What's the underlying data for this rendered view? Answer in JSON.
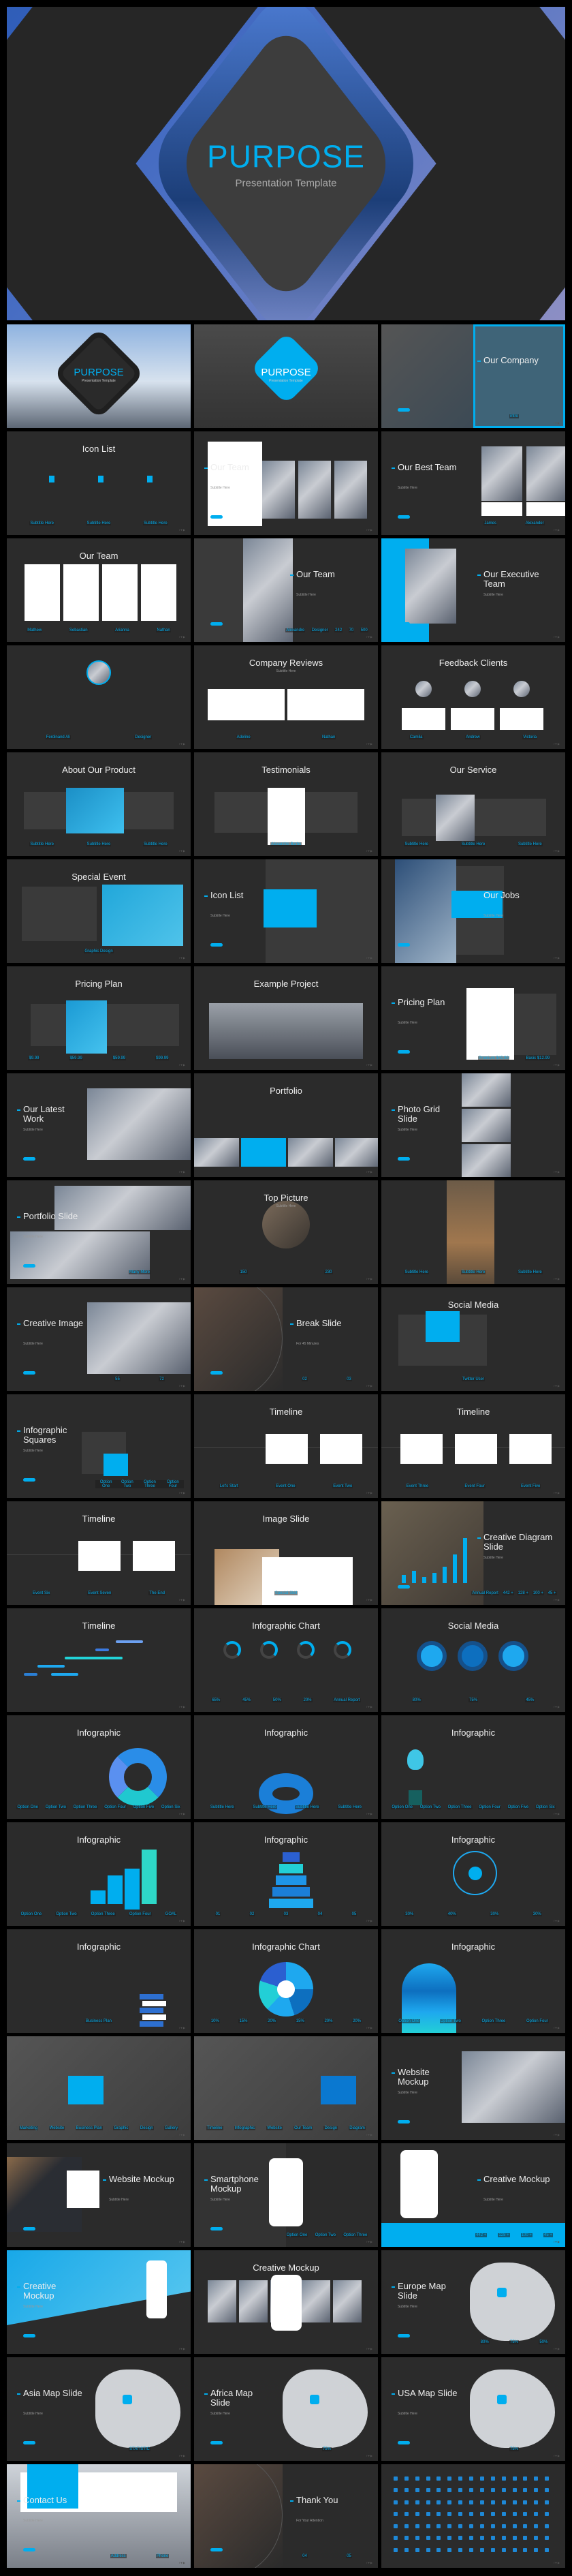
{
  "accent_color": "#00aeef",
  "background_color": "#2b2b2b",
  "hero": {
    "title": "PURPOSE",
    "subtitle": "Presentation Template"
  },
  "slides": [
    {
      "title": "PURPOSE",
      "subtitle": "Presentation Template",
      "layout": "cover",
      "deco": "cover-photo"
    },
    {
      "title": "PURPOSE",
      "subtitle": "Presentation Template",
      "layout": "cover",
      "deco": "cover-blue"
    },
    {
      "title": "Our Company",
      "layout": "left right-title",
      "deco": "company",
      "items": [
        "intro"
      ]
    },
    {
      "title": "Icon List",
      "layout": "center",
      "deco": "icons3",
      "items": [
        "Subtitle Here",
        "Subtitle Here",
        "Subtitle Here"
      ]
    },
    {
      "title": "Our Team",
      "subtitle": "Subtitle Here",
      "layout": "left",
      "deco": "team-photos"
    },
    {
      "title": "Our Best Team",
      "subtitle": "Subtitle Here",
      "layout": "left",
      "deco": "photo-right2",
      "items": [
        "James",
        "Alexander"
      ]
    },
    {
      "title": "Our Team",
      "layout": "center",
      "deco": "cards4",
      "items": [
        "Mathew",
        "Sebastian",
        "Arianna",
        "Nathan"
      ]
    },
    {
      "title": "Our Team",
      "subtitle": "Subtitle Here",
      "layout": "left right-title",
      "deco": "profile",
      "items": [
        "Alexandre",
        "Designer",
        "242",
        "70",
        "500"
      ]
    },
    {
      "title": "Our Executive Team",
      "subtitle": "Subtitle Here",
      "layout": "left right-title",
      "deco": "executive"
    },
    {
      "title": "",
      "layout": "center",
      "deco": "avatar",
      "items": [
        "Ferdinand Ali",
        "Designer"
      ]
    },
    {
      "title": "Company Reviews",
      "subtitle": "Subtitle Here",
      "layout": "center",
      "deco": "cards2",
      "items": [
        "Adeline",
        "Nathan"
      ]
    },
    {
      "title": "Feedback Clients",
      "layout": "center",
      "deco": "cards3",
      "items": [
        "Camila",
        "Andrew",
        "Victoria"
      ]
    },
    {
      "title": "About Our Product",
      "layout": "center",
      "deco": "panel3",
      "items": [
        "Subtitle Here",
        "Subtitle Here",
        "Subtitle Here"
      ]
    },
    {
      "title": "Testimonials",
      "layout": "center",
      "deco": "panel5",
      "items": [
        "Alexandre Barbs"
      ]
    },
    {
      "title": "Our Service",
      "layout": "center",
      "deco": "panel4",
      "items": [
        "Subtitle Here",
        "Subtitle Here",
        "Subtitle Here"
      ]
    },
    {
      "title": "Special Event",
      "layout": "center",
      "deco": "event",
      "items": [
        "Graphic Design"
      ]
    },
    {
      "title": "Icon List",
      "subtitle": "Subtitle Here",
      "layout": "left",
      "deco": "iconlist"
    },
    {
      "title": "Our Jobs",
      "subtitle": "Subtitle Here",
      "layout": "left right-title",
      "deco": "jobs"
    },
    {
      "title": "Pricing Plan",
      "layout": "center",
      "deco": "pricing4",
      "items": [
        "$9.99",
        "$59.99",
        "$59.99",
        "$99.99"
      ]
    },
    {
      "title": "Example Project",
      "layout": "center",
      "deco": "wide-photo"
    },
    {
      "title": "Pricing Plan",
      "subtitle": "Subtitle Here",
      "layout": "left",
      "deco": "pricing2",
      "items": [
        "Premium $49.99",
        "Basic $12.99"
      ]
    },
    {
      "title": "Our Latest Work",
      "subtitle": "Subtitle Here",
      "layout": "left",
      "deco": "photo-right"
    },
    {
      "title": "Portfolio",
      "layout": "center",
      "deco": "strip4"
    },
    {
      "title": "Photo Grid Slide",
      "subtitle": "Subtitle Here",
      "layout": "left",
      "deco": "photo-col"
    },
    {
      "title": "Portfolio Slide",
      "subtitle": "Subtitle Here",
      "layout": "left",
      "deco": "collage",
      "items": [
        "Many More"
      ]
    },
    {
      "title": "Top Picture",
      "subtitle": "Subtitle Here",
      "layout": "center",
      "deco": "circle",
      "items": [
        "150",
        "230"
      ]
    },
    {
      "title": "",
      "layout": "center",
      "deco": "sunset3",
      "items": [
        "Subtitle Here",
        "Subtitle Here",
        "Subtitle Here"
      ]
    },
    {
      "title": "Creative Image",
      "subtitle": "Subtitle Here",
      "layout": "left",
      "deco": "photo-right",
      "items": [
        "55",
        "72"
      ]
    },
    {
      "title": "Break Slide",
      "subtitle": "For 45 Minutes",
      "layout": "left right-title",
      "deco": "break",
      "items": [
        "02",
        "03"
      ]
    },
    {
      "title": "Social Media",
      "layout": "center",
      "deco": "social",
      "items": [
        "Twitter User"
      ]
    },
    {
      "title": "Infographic Squares",
      "subtitle": "Subtitle Here",
      "layout": "left",
      "deco": "squares",
      "items": [
        "Option One",
        "Option Two",
        "Option Three",
        "Option Four"
      ]
    },
    {
      "title": "Timeline",
      "layout": "center",
      "deco": "timeline2",
      "items": [
        "Let's Start",
        "Event One",
        "Event Two"
      ]
    },
    {
      "title": "Timeline",
      "layout": "center",
      "deco": "timeline3",
      "items": [
        "Event Three",
        "Event Four",
        "Event Five"
      ]
    },
    {
      "title": "Timeline",
      "layout": "center",
      "deco": "timeline2",
      "items": [
        "Event Six",
        "Event Seven",
        "The End"
      ]
    },
    {
      "title": "Image Slide",
      "layout": "center",
      "deco": "imageslide",
      "items": [
        "Special Skill"
      ]
    },
    {
      "title": "Creative Diagram Slide",
      "subtitle": "Subtitle Here",
      "layout": "left right-title",
      "deco": "diagram",
      "items": [
        "Annual Report",
        "442 +",
        "128 +",
        "100 +",
        "45 +"
      ]
    },
    {
      "title": "Timeline",
      "layout": "center",
      "deco": "gantt"
    },
    {
      "title": "Infographic Chart",
      "layout": "center",
      "deco": "donuts",
      "items": [
        "65%",
        "45%",
        "50%",
        "20%",
        "Annual Report"
      ]
    },
    {
      "title": "Social Media",
      "layout": "center",
      "deco": "social-rings",
      "items": [
        "80%",
        "75%",
        "45%"
      ]
    },
    {
      "title": "Infographic",
      "layout": "center",
      "deco": "arrow",
      "items": [
        "Option One",
        "Option Two",
        "Option Three",
        "Option Four",
        "Option Five",
        "Option Six"
      ]
    },
    {
      "title": "Infographic",
      "layout": "center",
      "deco": "ring",
      "items": [
        "Subtitle Here",
        "Subtitle Here",
        "Subtitle Here",
        "Subtitle Here"
      ]
    },
    {
      "title": "Infographic",
      "layout": "center",
      "deco": "bulb",
      "items": [
        "Option One",
        "Option Two",
        "Option Three",
        "Option Four",
        "Option Five",
        "Option Six"
      ]
    },
    {
      "title": "Infographic",
      "layout": "center",
      "deco": "goal",
      "items": [
        "Option One",
        "Option Two",
        "Option Three",
        "Option Four",
        "GOAL"
      ]
    },
    {
      "title": "Infographic",
      "layout": "center",
      "deco": "pyramid",
      "items": [
        "01",
        "02",
        "03",
        "04",
        "05"
      ]
    },
    {
      "title": "Infographic",
      "layout": "center",
      "deco": "network",
      "items": [
        "30%",
        "40%",
        "30%",
        "30%"
      ]
    },
    {
      "title": "Infographic",
      "layout": "center",
      "deco": "books",
      "items": [
        "Business Plan"
      ]
    },
    {
      "title": "Infographic Chart",
      "layout": "center",
      "deco": "pie",
      "items": [
        "10%",
        "15%",
        "20%",
        "15%",
        "20%",
        "20%"
      ]
    },
    {
      "title": "Infographic",
      "layout": "center",
      "deco": "head",
      "items": [
        "Option One",
        "Option Two",
        "Option Three",
        "Option Four"
      ]
    },
    {
      "title": "",
      "layout": "center",
      "deco": "grid-menu",
      "items": [
        "Marketing",
        "Website",
        "Business Plan",
        "Graphic",
        "Design",
        "Gallery"
      ]
    },
    {
      "title": "",
      "layout": "center",
      "deco": "grid-menu2",
      "items": [
        "Timeline",
        "Infographic",
        "Website",
        "Our Team",
        "Design",
        "Diagram"
      ]
    },
    {
      "title": "Website Mockup",
      "subtitle": "Subtitle Here",
      "layout": "left",
      "deco": "photo-right"
    },
    {
      "title": "Website Mockup",
      "subtitle": "Subtitle Here",
      "layout": "left right-title",
      "deco": "notebook"
    },
    {
      "title": "Smartphone Mockup",
      "subtitle": "Subtitle Here",
      "layout": "left",
      "deco": "phone",
      "items": [
        "Option One",
        "Option Two",
        "Option Three"
      ]
    },
    {
      "title": "Creative Mockup",
      "subtitle": "Subtitle Here",
      "layout": "left right-title",
      "deco": "phone-stats",
      "items": [
        "442 +",
        "128 +",
        "100 +",
        "45 +"
      ]
    },
    {
      "title": "Creative Mockup",
      "subtitle": "Subtitle Here",
      "layout": "left",
      "deco": "blue-slant"
    },
    {
      "title": "Creative Mockup",
      "layout": "center",
      "deco": "strip5"
    },
    {
      "title": "Europe Map Slide",
      "subtitle": "Subtitle Here",
      "layout": "left",
      "deco": "map",
      "items": [
        "80%",
        "75%",
        "50%"
      ]
    },
    {
      "title": "Asia Map Slide",
      "subtitle": "Subtitle Here",
      "layout": "left",
      "deco": "map",
      "items": [
        "STATISTIC"
      ]
    },
    {
      "title": "Africa Map Slide",
      "subtitle": "Subtitle Here",
      "layout": "left",
      "deco": "map",
      "items": [
        "75%"
      ]
    },
    {
      "title": "USA Map Slide",
      "subtitle": "Subtitle Here",
      "layout": "left",
      "deco": "map",
      "items": [
        "75%"
      ]
    },
    {
      "title": "Contact Us",
      "subtitle": "Subtitle Here",
      "layout": "left",
      "deco": "contact",
      "items": [
        "Address",
        "Phone"
      ]
    },
    {
      "title": "Thank You",
      "subtitle": "For Your Attention",
      "layout": "left right-title",
      "deco": "break",
      "items": [
        "04",
        "05"
      ]
    },
    {
      "title": "",
      "layout": "center",
      "deco": "icongrid"
    }
  ]
}
